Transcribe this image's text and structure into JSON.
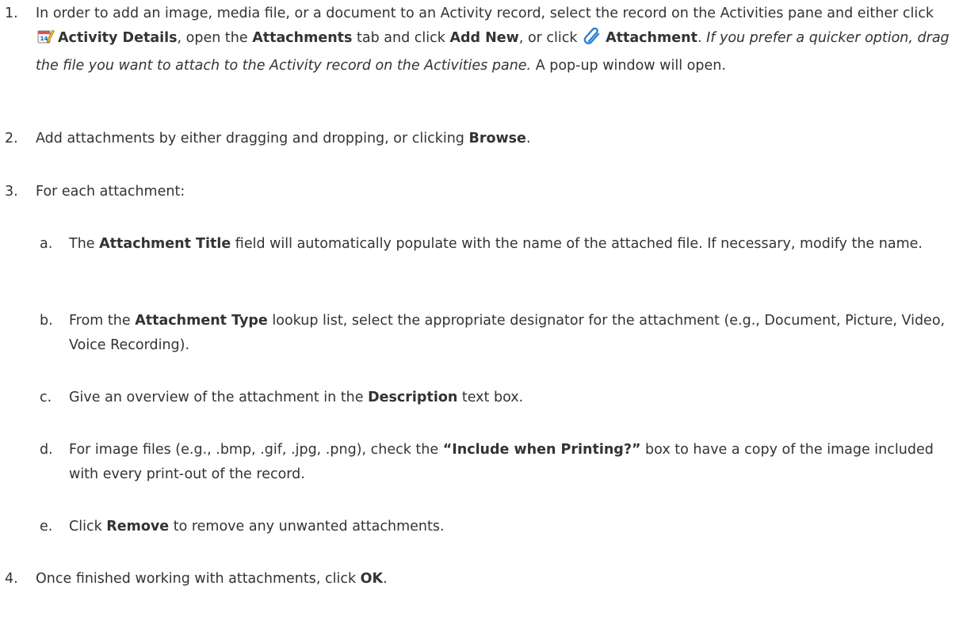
{
  "steps": [
    {
      "number": "1.",
      "parts": {
        "t1": "In order to add an image, media file, or a document to an Activity record, select the record on the Activities pane and either click ",
        "b1": "Activity Details",
        "t2": ", open the ",
        "b2": "Attachments",
        "t3": " tab and click ",
        "b3": "Add New",
        "t4": ", or click ",
        "b4": "Attachment",
        "t5": ". ",
        "i1": "If you prefer a quicker option, drag the file you want to attach to the Activity record on the Activities pane.",
        "t6": " A pop-up window will open."
      },
      "icons": [
        "activity-details-icon",
        "paperclip-icon"
      ]
    },
    {
      "number": "2.",
      "parts": {
        "t1": "Add attachments by either dragging and dropping, or clicking ",
        "b1": "Browse",
        "t2": "."
      }
    },
    {
      "number": "3.",
      "parts": {
        "t1": "For each attachment:"
      },
      "substeps": [
        {
          "letter": "a.",
          "t1": "The ",
          "b1": "Attachment Title",
          "t2": " field will automatically populate with the name of the attached file. If necessary, modify the name."
        },
        {
          "letter": "b.",
          "t1": "From the ",
          "b1": "Attachment Type",
          "t2": " lookup list, select the appropriate designator for the attachment (e.g., Document, Picture, Video, Voice Recording)."
        },
        {
          "letter": "c.",
          "t1": "Give an overview of the attachment in the ",
          "b1": "Description",
          "t2": " text box."
        },
        {
          "letter": "d.",
          "t1": "For image files (e.g., .bmp, .gif, .jpg, .png), check the ",
          "b1": "“Include when Printing?”",
          "t2": " box to have a copy of the image included with every print-out of the record."
        },
        {
          "letter": "e.",
          "t1": "Click ",
          "b1": "Remove",
          "t2": " to remove any unwanted attachments."
        }
      ]
    },
    {
      "number": "4.",
      "parts": {
        "t1": "Once finished working with attachments, click ",
        "b1": "OK",
        "t2": "."
      }
    }
  ]
}
